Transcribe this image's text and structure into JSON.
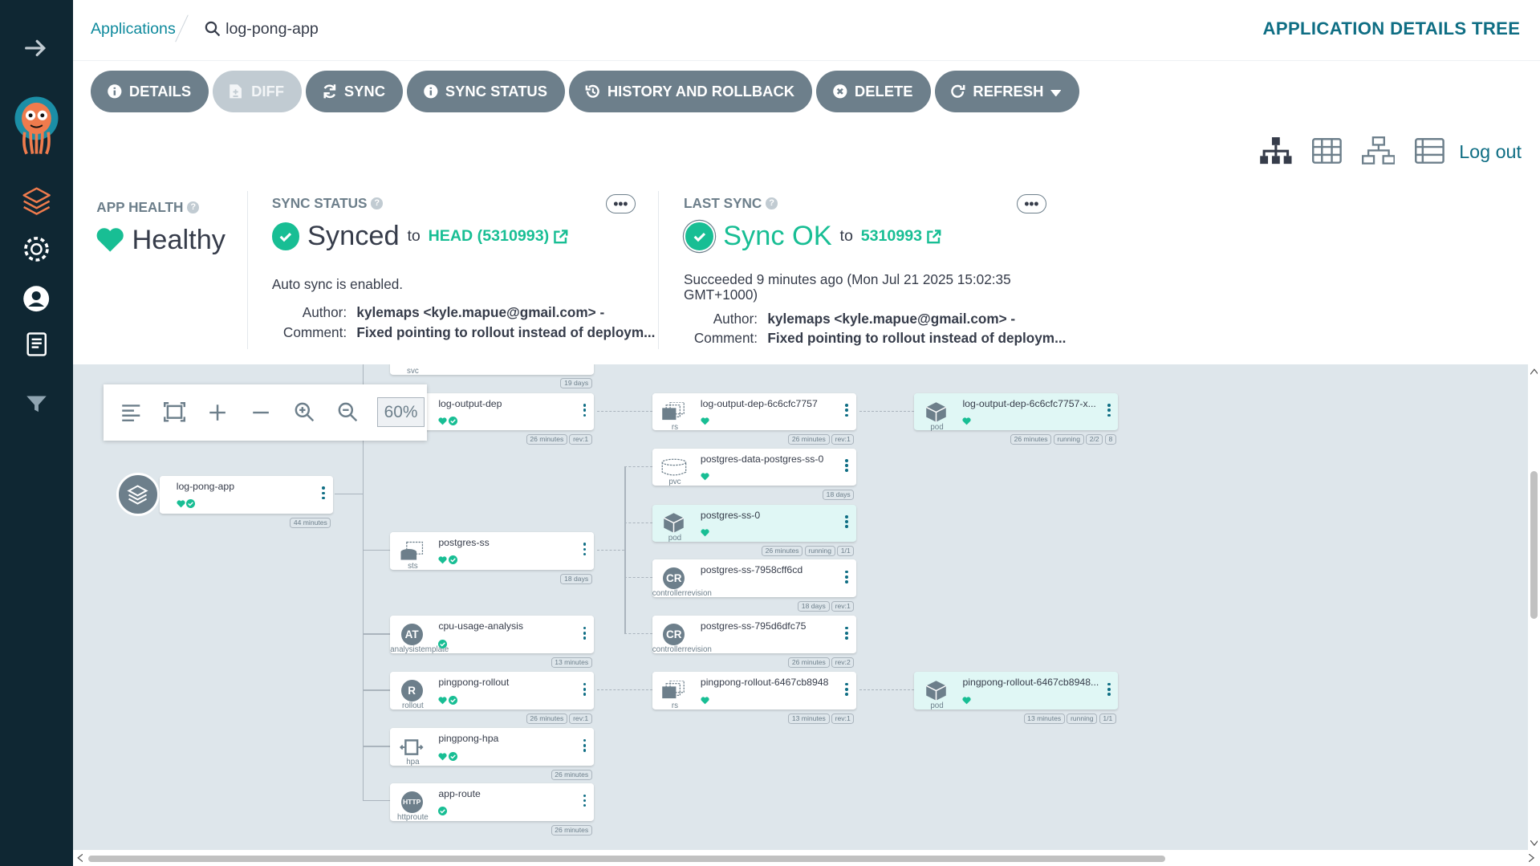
{
  "breadcrumb": {
    "apps": "Applications",
    "app": "log-pong-app"
  },
  "page_title": "APPLICATION DETAILS TREE",
  "toolbar": [
    {
      "label": "DETAILS",
      "icon": "info-icon",
      "disabled": false
    },
    {
      "label": "DIFF",
      "icon": "file-diff-icon",
      "disabled": true
    },
    {
      "label": "SYNC",
      "icon": "sync-icon",
      "disabled": false
    },
    {
      "label": "SYNC STATUS",
      "icon": "info-icon",
      "disabled": false
    },
    {
      "label": "HISTORY AND ROLLBACK",
      "icon": "history-icon",
      "disabled": false
    },
    {
      "label": "DELETE",
      "icon": "delete-icon",
      "disabled": false
    },
    {
      "label": "REFRESH",
      "icon": "refresh-icon",
      "disabled": false
    }
  ],
  "logout": "Log out",
  "app_health": {
    "title": "APP HEALTH",
    "value": "Healthy"
  },
  "sync_status": {
    "title": "SYNC STATUS",
    "value": "Synced",
    "to": "to",
    "target": "HEAD (5310993)",
    "note": "Auto sync is enabled.",
    "author_label": "Author:",
    "author": "kylemaps <kyle.mapue@gmail.com> -",
    "comment_label": "Comment:",
    "comment": "Fixed pointing to rollout instead of deploym..."
  },
  "last_sync": {
    "title": "LAST SYNC",
    "value": "Sync OK",
    "to": "to",
    "target": "5310993",
    "note": "Succeeded 9 minutes ago (Mon Jul 21 2025 15:02:35 GMT+1000)",
    "author_label": "Author:",
    "author": "kylemaps <kyle.mapue@gmail.com> -",
    "comment_label": "Comment:",
    "comment": "Fixed pointing to rollout instead of deploym..."
  },
  "zoom": "60%",
  "colors": {
    "sidebar": "#0f2733",
    "accent": "#0f6e84",
    "healthy": "#18be94",
    "button": "#6d7f8b"
  },
  "nodes": {
    "svc": {
      "kind": "svc",
      "tags": [
        "19 days"
      ]
    },
    "root": {
      "name": "log-pong-app",
      "tags": [
        "44 minutes"
      ]
    },
    "dep": {
      "name": "log-output-dep",
      "kind": "",
      "tags": [
        "26 minutes",
        "rev:1"
      ]
    },
    "rs1": {
      "name": "log-output-dep-6c6cfc7757",
      "kind": "rs",
      "tags": [
        "26 minutes",
        "rev:1"
      ]
    },
    "pod1": {
      "name": "log-output-dep-6c6cfc7757-x...",
      "kind": "pod",
      "tags": [
        "26 minutes",
        "running",
        "2/2",
        "8"
      ]
    },
    "pvc": {
      "name": "postgres-data-postgres-ss-0",
      "kind": "pvc",
      "tags": [
        "18 days"
      ]
    },
    "sts": {
      "name": "postgres-ss",
      "kind": "sts",
      "tags": [
        "18 days"
      ]
    },
    "pod2": {
      "name": "postgres-ss-0",
      "kind": "pod",
      "tags": [
        "26 minutes",
        "running",
        "1/1"
      ]
    },
    "cr1": {
      "name": "postgres-ss-7958cff6cd",
      "kind": "controllerrevision",
      "icon": "CR",
      "tags": [
        "18 days",
        "rev:1"
      ]
    },
    "cr2": {
      "name": "postgres-ss-795d6dfc75",
      "kind": "controllerrevision",
      "icon": "CR",
      "tags": [
        "26 minutes",
        "rev:2"
      ]
    },
    "at": {
      "name": "cpu-usage-analysis",
      "kind": "analysistemplate",
      "icon": "AT",
      "tags": [
        "13 minutes"
      ]
    },
    "ro": {
      "name": "pingpong-rollout",
      "kind": "rollout",
      "icon": "R",
      "tags": [
        "26 minutes",
        "rev:1"
      ]
    },
    "rs2": {
      "name": "pingpong-rollout-6467cb8948",
      "kind": "rs",
      "tags": [
        "13 minutes",
        "rev:1"
      ]
    },
    "pod3": {
      "name": "pingpong-rollout-6467cb8948...",
      "kind": "pod",
      "tags": [
        "13 minutes",
        "running",
        "1/1"
      ]
    },
    "hpa": {
      "name": "pingpong-hpa",
      "kind": "hpa",
      "tags": [
        "26 minutes"
      ]
    },
    "route": {
      "name": "app-route",
      "kind": "httproute",
      "icon": "HTTP",
      "tags": [
        "26 minutes"
      ]
    }
  }
}
